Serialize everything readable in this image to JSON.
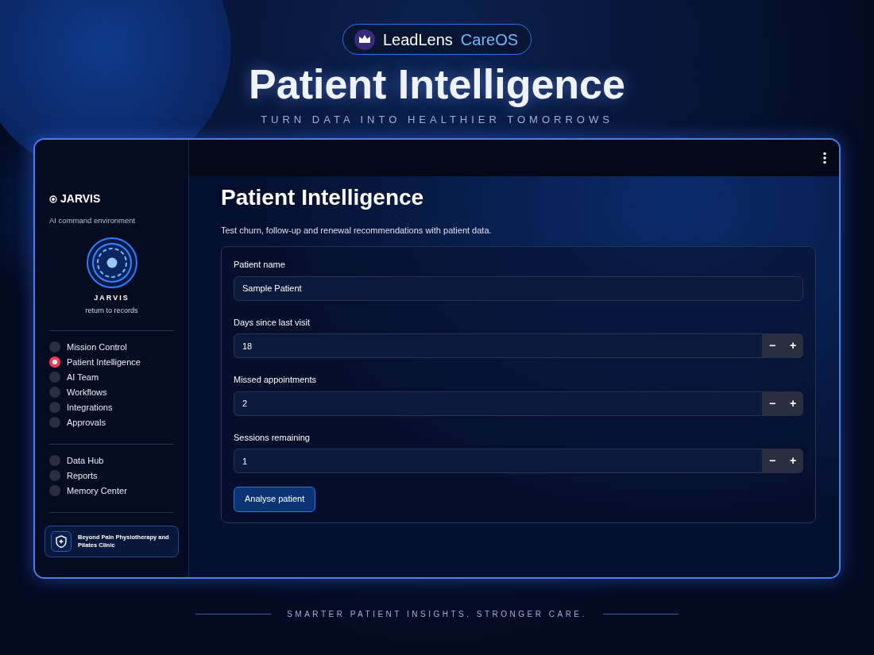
{
  "banner": {
    "brand": "LeadLens",
    "product": "CareOS",
    "headline": "Patient Intelligence",
    "tagline": "TURN DATA INTO HEALTHIER TOMORROWS"
  },
  "sidebar": {
    "title": "JARVIS",
    "subtitle": "AI command environment",
    "orb_label": "JARVIS",
    "orb_caption": "return to records",
    "groups": [
      {
        "items": [
          {
            "label": "Mission Control",
            "selected": false
          },
          {
            "label": "Patient Intelligence",
            "selected": true
          },
          {
            "label": "AI Team",
            "selected": false
          },
          {
            "label": "Workflows",
            "selected": false
          },
          {
            "label": "Integrations",
            "selected": false
          },
          {
            "label": "Approvals",
            "selected": false
          }
        ]
      },
      {
        "items": [
          {
            "label": "Data Hub",
            "selected": false
          },
          {
            "label": "Reports",
            "selected": false
          },
          {
            "label": "Memory Center",
            "selected": false
          }
        ]
      }
    ],
    "clinic": "Beyond Pain Physiotherapy and Pilates Clinic"
  },
  "main": {
    "title": "Patient Intelligence",
    "description": "Test churn, follow-up and renewal recommendations with patient data.",
    "fields": [
      {
        "kind": "text",
        "label": "Patient name",
        "value": "Sample Patient"
      },
      {
        "kind": "number",
        "label": "Days since last visit",
        "value": "18",
        "minus": "−",
        "plus": "+"
      },
      {
        "kind": "number",
        "label": "Missed appointments",
        "value": "2",
        "minus": "−",
        "plus": "+"
      },
      {
        "kind": "number",
        "label": "Sessions remaining",
        "value": "1",
        "minus": "−",
        "plus": "+"
      }
    ],
    "button": "Analyse patient"
  },
  "footer": {
    "tagline": "SMARTER PATIENT INSIGHTS. STRONGER CARE."
  }
}
